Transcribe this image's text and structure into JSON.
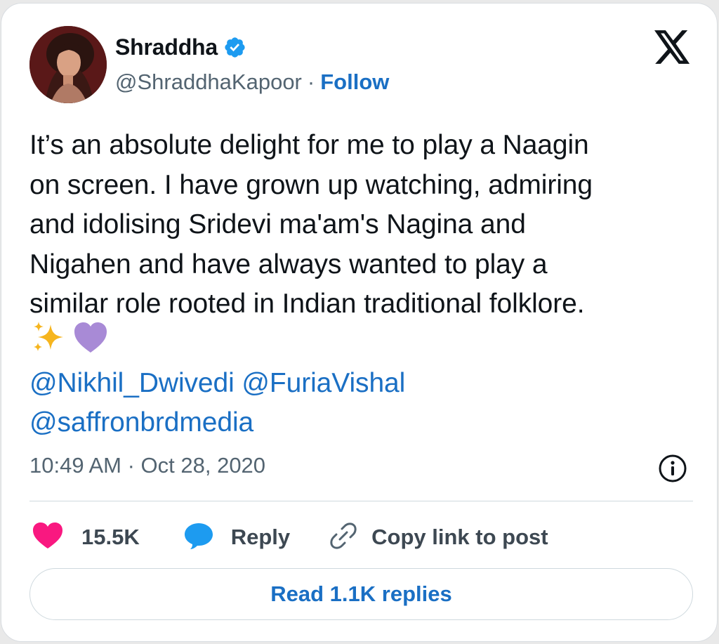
{
  "author": {
    "display_name": "Shraddha",
    "handle": "@ShraddhaKapoor",
    "separator": "·",
    "follow_label": "Follow",
    "verified": true
  },
  "tweet": {
    "lines": [
      "It’s an absolute delight for me to play a Naagin",
      "on screen. I have grown up watching, admiring",
      "and idolising Sridevi ma'am's Nagina and",
      "Nigahen and have always wanted to play a",
      "similar role rooted in Indian traditional folklore."
    ],
    "emojis": [
      "sparkles-emoji",
      "purple-heart-emoji"
    ],
    "mentions": [
      "@Nikhil_Dwivedi",
      "@FuriaVishal",
      "@saffronbrdmedia"
    ],
    "timestamp": "10:49 AM · Oct 28, 2020"
  },
  "actions": {
    "like_count": "15.5K",
    "reply_label": "Reply",
    "copy_link_label": "Copy link to post"
  },
  "read_replies_label": "Read 1.1K replies",
  "colors": {
    "link": "#1a6fc4",
    "like": "#f91880",
    "verified": "#1d9bf0",
    "reply_icon": "#1d9bf0",
    "muted_text": "#536471"
  },
  "icons": {
    "brand": "x-logo-icon",
    "verified": "verified-badge-icon",
    "info": "info-icon",
    "like": "heart-icon",
    "reply": "speech-bubble-icon",
    "copy": "link-icon"
  }
}
